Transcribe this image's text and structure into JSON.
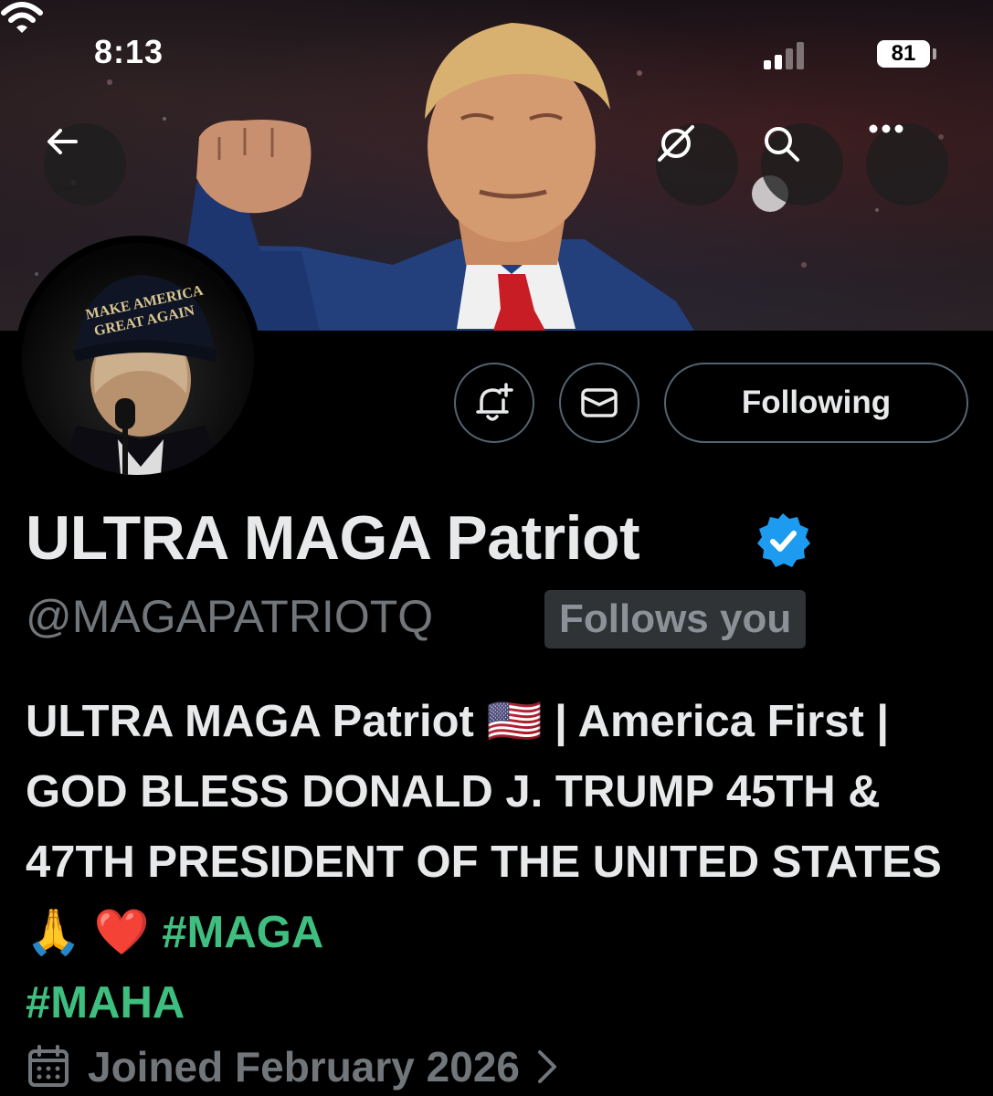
{
  "status_bar": {
    "time": "8:13",
    "battery": "81"
  },
  "banner": {
    "description_icon": "banner-photo",
    "cap_text": "MAKE AMERICA GREAT AGAIN"
  },
  "nav": {
    "back_icon": "arrow-left-icon",
    "grok_icon": "grok-icon",
    "search_icon": "search-icon",
    "more_icon": "more-icon"
  },
  "actions": {
    "notify_icon": "bell-plus-icon",
    "message_icon": "envelope-icon",
    "following_label": "Following"
  },
  "profile": {
    "display_name": "ULTRA MAGA Patriot",
    "handle": "@MAGAPATRIOTQ",
    "follows_you": "Follows you",
    "bio_prefix": "ULTRA MAGA Patriot 🇺🇸 | America First | GOD BLESS DONALD J. TRUMP 45TH & 47TH PRESIDENT OF THE UNITED STATES 🙏 ❤️ ",
    "hashtags": [
      "#MAGA",
      "#MAHA"
    ],
    "joined": "Joined February 2026"
  },
  "colors": {
    "background": "#000000",
    "text_primary": "#e7e9ea",
    "text_secondary": "#71767b",
    "verified_blue": "#1d9bf0",
    "hashtag_green": "#3fbf7f"
  }
}
